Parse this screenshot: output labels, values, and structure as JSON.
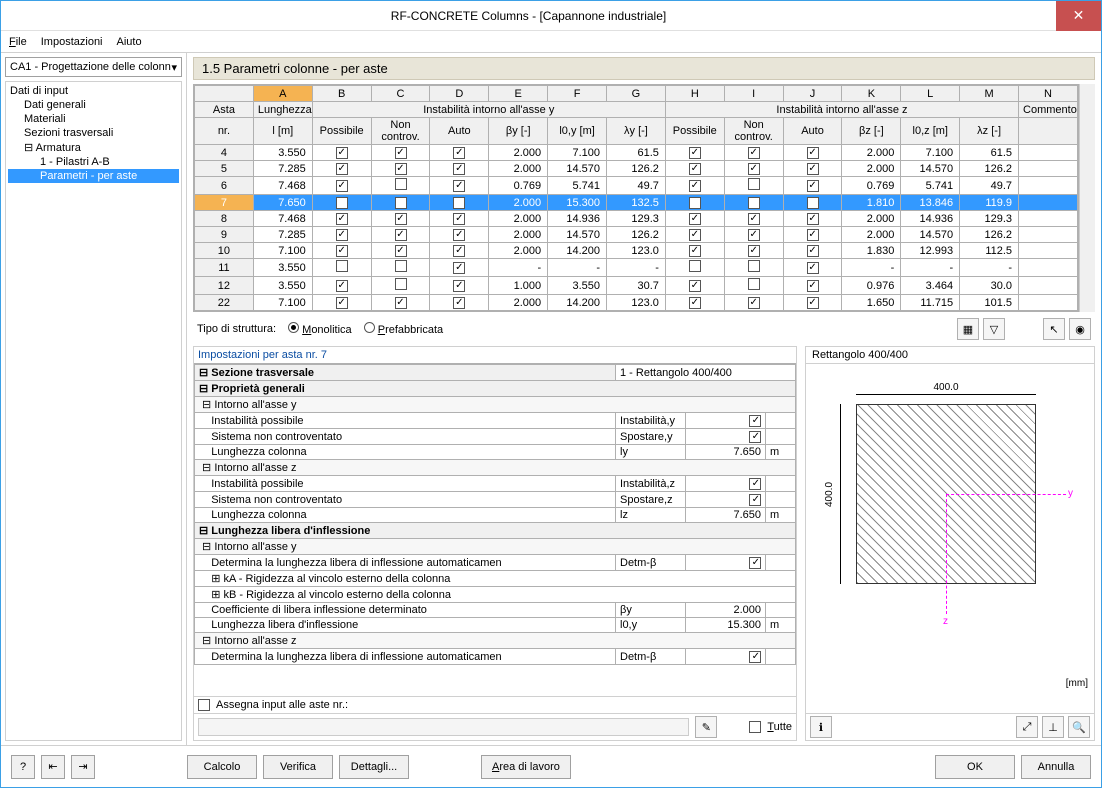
{
  "window": {
    "title": "RF-CONCRETE Columns - [Capannone industriale]"
  },
  "menu": {
    "file": "File",
    "settings": "Impostazioni",
    "help": "Aiuto"
  },
  "combo": {
    "value": "CA1 - Progettazione delle colonn"
  },
  "tree": {
    "root": "Dati di input",
    "items": [
      "Dati generali",
      "Materiali",
      "Sezioni trasversali"
    ],
    "armatura": "Armatura",
    "arm1": "1 - Pilastri A-B",
    "paramperaste": "Parametri - per aste"
  },
  "section_title": "1.5 Parametri colonne - per aste",
  "colLetters": [
    "A",
    "B",
    "C",
    "D",
    "E",
    "F",
    "G",
    "H",
    "I",
    "J",
    "K",
    "L",
    "M",
    "N"
  ],
  "headers": {
    "asta": "Asta",
    "nr": "nr.",
    "lung": "Lunghezza",
    "lm": "l [m]",
    "instY": "Instabilità intorno all'asse y",
    "instZ": "Instabilità intorno all'asse z",
    "possibile": "Possibile",
    "noncontrov": "Non controv.",
    "auto": "Auto",
    "by": "βy [-]",
    "loy": "l0,y [m]",
    "ly": "λy [-]",
    "bz": "βz [-]",
    "loz": "l0,z [m]",
    "lz": "λz [-]",
    "commento": "Commento"
  },
  "rows": [
    {
      "n": "4",
      "l": "3.550",
      "py": true,
      "ny": true,
      "ay": true,
      "by": "2.000",
      "loy": "7.100",
      "ly": "61.5",
      "pz": true,
      "nz": true,
      "az": true,
      "bz": "2.000",
      "loz": "7.100",
      "lz": "61.5"
    },
    {
      "n": "5",
      "l": "7.285",
      "py": true,
      "ny": true,
      "ay": true,
      "by": "2.000",
      "loy": "14.570",
      "ly": "126.2",
      "pz": true,
      "nz": true,
      "az": true,
      "bz": "2.000",
      "loz": "14.570",
      "lz": "126.2"
    },
    {
      "n": "6",
      "l": "7.468",
      "py": true,
      "ny": false,
      "ay": true,
      "by": "0.769",
      "loy": "5.741",
      "ly": "49.7",
      "pz": true,
      "nz": false,
      "az": true,
      "bz": "0.769",
      "loz": "5.741",
      "lz": "49.7"
    },
    {
      "n": "7",
      "l": "7.650",
      "py": true,
      "ny": true,
      "ay": true,
      "by": "2.000",
      "loy": "15.300",
      "ly": "132.5",
      "pz": true,
      "nz": true,
      "az": true,
      "bz": "1.810",
      "loz": "13.846",
      "lz": "119.9",
      "sel": true
    },
    {
      "n": "8",
      "l": "7.468",
      "py": true,
      "ny": true,
      "ay": true,
      "by": "2.000",
      "loy": "14.936",
      "ly": "129.3",
      "pz": true,
      "nz": true,
      "az": true,
      "bz": "2.000",
      "loz": "14.936",
      "lz": "129.3"
    },
    {
      "n": "9",
      "l": "7.285",
      "py": true,
      "ny": true,
      "ay": true,
      "by": "2.000",
      "loy": "14.570",
      "ly": "126.2",
      "pz": true,
      "nz": true,
      "az": true,
      "bz": "2.000",
      "loz": "14.570",
      "lz": "126.2"
    },
    {
      "n": "10",
      "l": "7.100",
      "py": true,
      "ny": true,
      "ay": true,
      "by": "2.000",
      "loy": "14.200",
      "ly": "123.0",
      "pz": true,
      "nz": true,
      "az": true,
      "bz": "1.830",
      "loz": "12.993",
      "lz": "112.5"
    },
    {
      "n": "11",
      "l": "3.550",
      "py": false,
      "ny": false,
      "ay": true,
      "by": "-",
      "loy": "-",
      "ly": "-",
      "pz": false,
      "nz": false,
      "az": true,
      "bz": "-",
      "loz": "-",
      "lz": "-"
    },
    {
      "n": "12",
      "l": "3.550",
      "py": true,
      "ny": false,
      "ay": true,
      "by": "1.000",
      "loy": "3.550",
      "ly": "30.7",
      "pz": true,
      "nz": false,
      "az": true,
      "bz": "0.976",
      "loz": "3.464",
      "lz": "30.0"
    },
    {
      "n": "22",
      "l": "7.100",
      "py": true,
      "ny": true,
      "ay": true,
      "by": "2.000",
      "loy": "14.200",
      "ly": "123.0",
      "pz": true,
      "nz": true,
      "az": true,
      "bz": "1.650",
      "loz": "11.715",
      "lz": "101.5"
    }
  ],
  "struct": {
    "label": "Tipo di struttura:",
    "mono": "Monolitica",
    "prefab": "Prefabbricata"
  },
  "settings": {
    "title": "Impostazioni per asta nr. 7",
    "sezione": "Sezione trasversale",
    "sezval": "1 - Rettangolo 400/400",
    "props": "Proprietà generali",
    "intY": "Intorno all'asse y",
    "intZ": "Intorno all'asse z",
    "instposs": "Instabilità possibile",
    "instY": "Instabilità,y",
    "instZ": "Instabilità,z",
    "sisnc": "Sistema non controventato",
    "spostY": "Spostare,y",
    "spostZ": "Spostare,z",
    "lungcol": "Lunghezza colonna",
    "lyy": "ly",
    "lzz": "lz",
    "v7650": "7.650",
    "m": "m",
    "llinf": "Lunghezza libera d'inflessione",
    "detauto": "Determina la lunghezza libera di inflessione automaticamen",
    "detmb": "Detm-β",
    "ka": "kA - Rigidezza al vincolo esterno della colonna",
    "kb": "kB - Rigidezza al vincolo esterno della colonna",
    "coefinf": "Coefficiente di libera inflessione determinato",
    "By": "βy",
    "v2": "2.000",
    "lunginf": "Lunghezza libera d'inflessione",
    "l0y": "l0,y",
    "v15300": "15.300"
  },
  "assign": {
    "label": "Assegna input alle aste nr.:",
    "tutte": "Tutte"
  },
  "preview": {
    "title": "Rettangolo 400/400",
    "w": "400.0",
    "h": "400.0",
    "unit": "[mm]"
  },
  "footer": {
    "calc": "Calcolo",
    "verif": "Verifica",
    "dett": "Dettagli...",
    "area": "Area di lavoro",
    "ok": "OK",
    "annulla": "Annulla"
  }
}
